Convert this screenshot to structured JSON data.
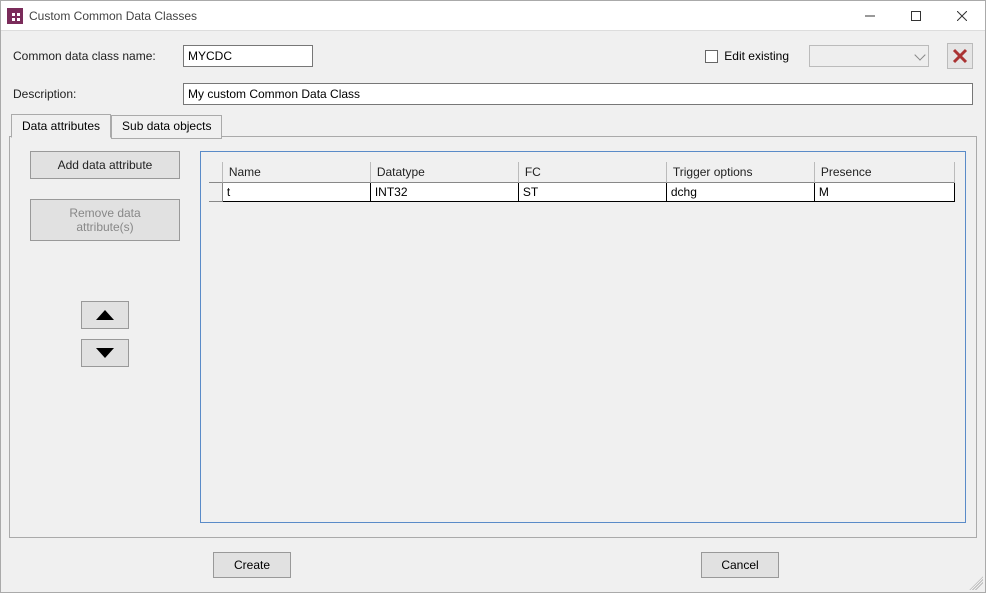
{
  "window": {
    "title": "Custom Common Data Classes"
  },
  "form": {
    "name_label": "Common data class name:",
    "name_value": "MYCDC",
    "edit_existing_label": "Edit existing",
    "edit_existing_checked": false,
    "description_label": "Description:",
    "description_value": "My custom Common Data Class"
  },
  "tabs": {
    "data_attributes_label": "Data attributes",
    "sub_data_objects_label": "Sub data objects"
  },
  "buttons": {
    "add_attribute": "Add data attribute",
    "remove_attribute": "Remove data attribute(s)",
    "create": "Create",
    "cancel": "Cancel"
  },
  "grid": {
    "columns": {
      "name": "Name",
      "datatype": "Datatype",
      "fc": "FC",
      "trigger": "Trigger options",
      "presence": "Presence"
    },
    "rows": [
      {
        "name": "t",
        "datatype": "INT32",
        "fc": "ST",
        "trigger": "dchg",
        "presence": "M"
      }
    ]
  }
}
